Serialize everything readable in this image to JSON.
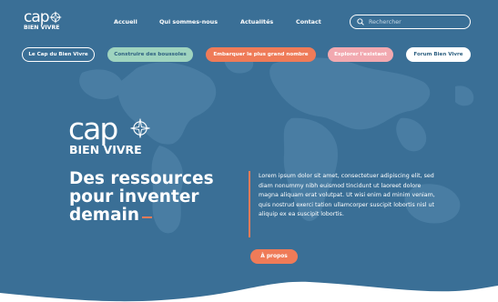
{
  "brand": {
    "logo_word": "cap",
    "logo_sub": "BIEN VIVRE"
  },
  "nav": {
    "items": [
      {
        "label": "Accueil"
      },
      {
        "label": "Qui sommes-nous"
      },
      {
        "label": "Actualités"
      },
      {
        "label": "Contact"
      }
    ],
    "search_placeholder": "Rechercher"
  },
  "pills": [
    {
      "label": "Le Cap du Bien Vivre",
      "bg": "#3a6f96",
      "fg": "#ffffff",
      "border": "#ffffff"
    },
    {
      "label": "Construire des boussoles",
      "bg": "#9fd4bf",
      "fg": "#2d5f80",
      "border": "#9fd4bf"
    },
    {
      "label": "Embarquer le plus grand nombre",
      "bg": "#ef7b58",
      "fg": "#ffffff",
      "border": "#ef7b58"
    },
    {
      "label": "Explorer l'existant",
      "bg": "#f2a9b0",
      "fg": "#ffffff",
      "border": "#f2a9b0"
    },
    {
      "label": "Forum Bien Vivre",
      "bg": "#ffffff",
      "fg": "#2d5f80",
      "border": "#ffffff"
    }
  ],
  "hero": {
    "headline": "Des ressources pour inventer demain",
    "body": "Lorem ipsum dolor sit amet, consectetuer adipiscing elit, sed diam nonummy nibh euismod tincidunt ut laoreet dolore magna aliquam erat volutpat. Ut wisi enim ad minim veniam, quis nostrud exerci tation ullamcorper suscipit lobortis nisl ut aliquip ex ea  suscipit lobortis.",
    "cta_label": "À propos"
  },
  "colors": {
    "background": "#3a6f96",
    "accent": "#ef7b58",
    "map": "#4a7ea4"
  }
}
